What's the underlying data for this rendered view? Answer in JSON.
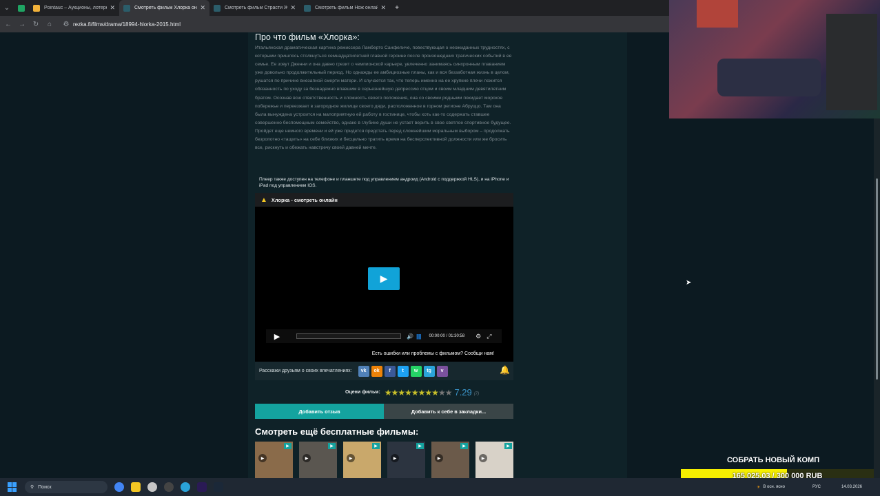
{
  "browser": {
    "tabs": [
      {
        "title": "Pointauc – Аукционы, лотереи",
        "color": "#f1b13a",
        "active": false
      },
      {
        "title": "Смотреть фильм Хлорка онлайн",
        "color": "#2b5d6a",
        "active": true
      },
      {
        "title": "Смотреть фильм Страсти Жанны",
        "color": "#2b5d6a",
        "active": false
      },
      {
        "title": "Смотреть фильм Нож онлайн",
        "color": "#2b5d6a",
        "active": false
      }
    ],
    "new_tab": "+",
    "url": "rezka.fi/films/drama/18994-hlorka-2015.html"
  },
  "movie": {
    "section_title": "Про что фильм «Хлорка»:",
    "description": "Итальянская драматическая картина режиссера Ламберто Санфеличе, повествующая о неожиданных трудностях, с которыми пришлось столкнуться семнадцатилетней главной героине после произошедших трагических событий в ее семье. Ее зовут Дженни и она давно грезит о чемпионской карьере, увлеченно занимаясь синхронным плаванием уже довольно продолжительный период. Но однажды ее амбициозные планы, как и вся беззаботная жизнь в целом, рушатся по причине внезапной смерти матери. И случается так, что теперь именно на ее хрупкие плечи ложится обязанность по уходу за безнадежно впавшим в серьезнейшую депрессию отцом и своим младшим девятилетним братом. Осознав всю ответственность и сложность своего положения, она со своими родными покидает морское побережье и переезжает в загородное жилище своего дяди, расположенное в горном регионе Абруццо. Там она была вынуждена устроится на малоприятную ей работу в гостинице, чтобы хоть как-то содержать ставшее совершенно беспомощным семейство, однако в глубине души не устает верить в свое светлое спортивное будущее. Пройдет еще немного времени и ей уже придется предстать перед сложнейшим моральным выбором – продолжать безропотно «тащить» на себе близких и бесцельно тратить время на бесперспективной должности или же бросить все, рискнуть и обежать навстречу своей давней мечте."
  },
  "player": {
    "note": "Плеер также доступен на телефоне и планшете под управлением андроид (Android с поддержкой HLS), и на iPhone и iPad под управлением IOS.",
    "header": "Хлорка - смотреть онлайн",
    "time": "00:00:00 / 01:30:58",
    "progress": 0,
    "report": "Есть ошибки или проблемы с фильмом? Сообщи нам!"
  },
  "share": {
    "label": "Расскажи друзьям о своих впечатлениях:",
    "icons": [
      {
        "name": "vk-icon",
        "glyph": "vk",
        "color": "#5181b8"
      },
      {
        "name": "odnoklassniki-icon",
        "glyph": "ok",
        "color": "#ee8208"
      },
      {
        "name": "facebook-icon",
        "glyph": "f",
        "color": "#3b5998"
      },
      {
        "name": "twitter-icon",
        "glyph": "t",
        "color": "#1da1f2"
      },
      {
        "name": "whatsapp-icon",
        "glyph": "w",
        "color": "#25d366"
      },
      {
        "name": "telegram-icon",
        "glyph": "tg",
        "color": "#2aa3d9"
      },
      {
        "name": "viber-icon",
        "glyph": "v",
        "color": "#7b519d"
      }
    ]
  },
  "rating": {
    "label": "Оцени фильм:",
    "value": "7.29",
    "votes": "(7)",
    "stars_filled": 8,
    "stars_total": 10
  },
  "buttons": {
    "add_review": "Добавить отзыв",
    "bookmark": "Добавить к себе в закладки..."
  },
  "more": {
    "title": "Смотреть ещё бесплатные фильмы:",
    "thumbs": [
      {
        "color": "#8a6b4a"
      },
      {
        "color": "#5a5650"
      },
      {
        "color": "#c9a86b"
      },
      {
        "color": "#2c3440"
      },
      {
        "color": "#6b5a4a"
      },
      {
        "color": "#d8d2c8"
      }
    ]
  },
  "donation": {
    "title": "СОБРАТЬ НОВЫЙ КОМП",
    "amount": "165 025.03 / 300 000 RUB",
    "progress": 0.55
  },
  "taskbar": {
    "search": "Поиск",
    "weather": "В осн. ясно",
    "lang": "РУС",
    "date": "14.03.2026"
  }
}
